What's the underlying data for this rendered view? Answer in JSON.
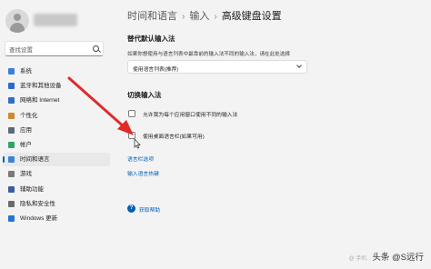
{
  "sidebar": {
    "search_placeholder": "查找设置",
    "items": [
      {
        "label": "系统",
        "icon": "system-icon",
        "color": "#3d7fd6"
      },
      {
        "label": "蓝牙和其他设备",
        "icon": "bluetooth-icon",
        "color": "#2a6ad0"
      },
      {
        "label": "网络和 Internet",
        "icon": "wifi-icon",
        "color": "#2f6fc4"
      },
      {
        "label": "个性化",
        "icon": "brush-icon",
        "color": "#d08a2e"
      },
      {
        "label": "应用",
        "icon": "apps-icon",
        "color": "#5a6b7b"
      },
      {
        "label": "帐户",
        "icon": "account-icon",
        "color": "#2fa36b"
      },
      {
        "label": "时间和语言",
        "icon": "time-language-icon",
        "color": "#3b82d6",
        "active": true
      },
      {
        "label": "游戏",
        "icon": "game-icon",
        "color": "#7a7a7a"
      },
      {
        "label": "辅助功能",
        "icon": "accessibility-icon",
        "color": "#3a5e9e"
      },
      {
        "label": "隐私和安全性",
        "icon": "shield-icon",
        "color": "#6b6b6b"
      },
      {
        "label": "Windows 更新",
        "icon": "update-icon",
        "color": "#1f79d4"
      }
    ]
  },
  "breadcrumb": {
    "item1": "时间和语言",
    "item2": "输入",
    "current": "高级键盘设置",
    "sep": "›"
  },
  "override": {
    "title": "替代默认输入法",
    "description": "如果你想使用与语言列表中最靠前的输入法不同的输入法，请在此处选择",
    "dropdown_value": "使用语言列表(推荐)"
  },
  "switching": {
    "title": "切换输入法",
    "option1": "允许我为每个应用窗口使用不同的输入法",
    "option2": "使用桌面语言栏(如果可用)",
    "link1": "语言栏选项",
    "link2": "输入语言热键"
  },
  "help": {
    "label": "获取帮助",
    "icon_glyph": "?"
  },
  "watermark": {
    "faint": "@ 手机",
    "text": "头条 @S远行"
  },
  "colors": {
    "accent": "#005fb8",
    "arrow": "#e02a2a"
  }
}
